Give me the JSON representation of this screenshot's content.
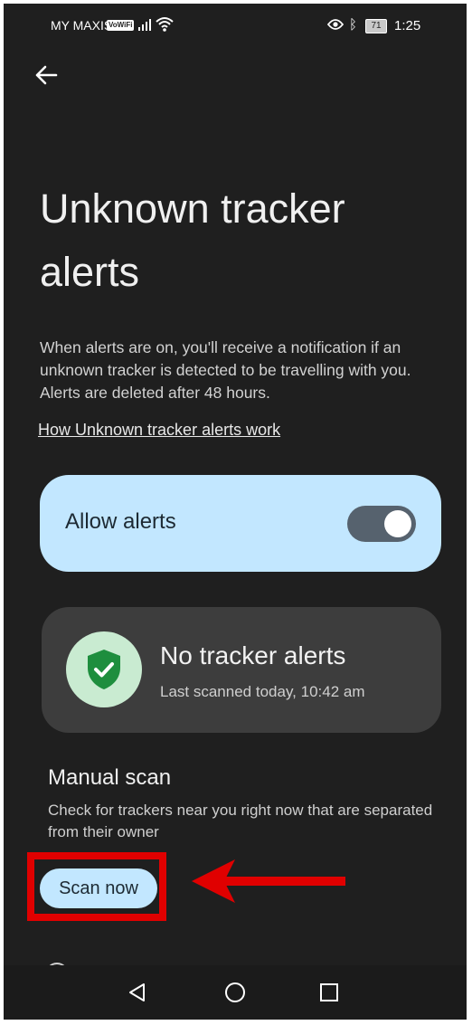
{
  "status_bar": {
    "carrier": "MY MAXIS",
    "vowifi": "VoWiFi",
    "battery": "71",
    "time": "1:25"
  },
  "page": {
    "title": "Unknown tracker alerts",
    "description": "When alerts are on, you'll receive a notification if an unknown tracker is detected to be travelling with you. Alerts are deleted after 48 hours.",
    "link": "How Unknown tracker alerts work"
  },
  "allow_alerts": {
    "label": "Allow alerts",
    "enabled": true
  },
  "status_card": {
    "title": "No tracker alerts",
    "subtitle": "Last scanned today, 10:42 am"
  },
  "manual_scan": {
    "title": "Manual scan",
    "description": "Check for trackers near you right now that are separated from their owner",
    "button_label": "Scan now"
  },
  "colors": {
    "background": "#1f1f1f",
    "accent_card": "#c2e7ff",
    "status_card": "#3d3d3d",
    "shield_green": "#1e8e3e",
    "highlight_red": "#e00000"
  },
  "icons": {
    "back": "arrow-left-icon",
    "shield": "shield-check-icon",
    "nav_back": "triangle-back-icon",
    "nav_home": "circle-home-icon",
    "nav_recent": "square-recent-icon"
  }
}
